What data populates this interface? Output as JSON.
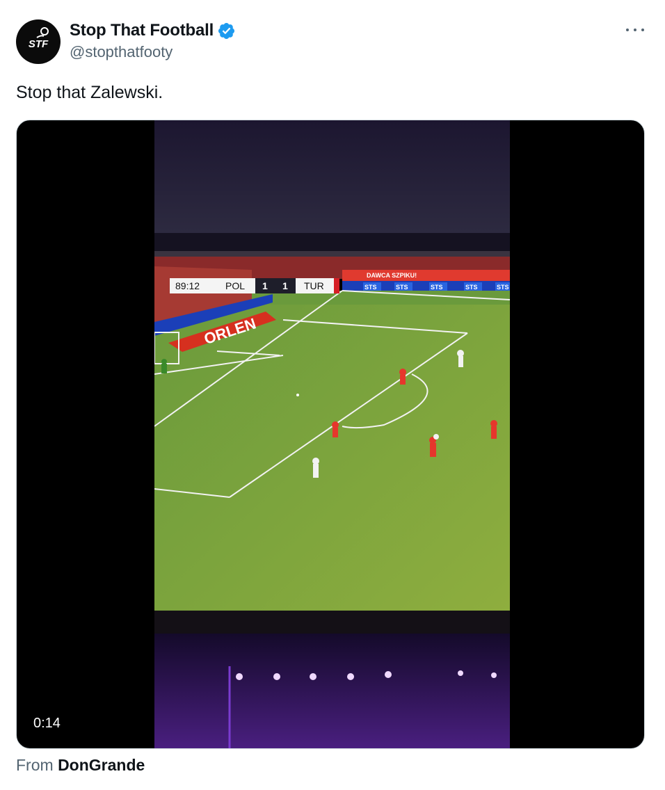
{
  "author": {
    "display_name": "Stop That Football",
    "handle": "@stopthatfooty",
    "avatar_initials": "STF",
    "verified": true
  },
  "tweet": {
    "text": "Stop that Zalewski."
  },
  "video": {
    "duration": "0:14",
    "scoreboard": {
      "clock": "89:12",
      "home_team": "POL",
      "home_score": "1",
      "away_score": "1",
      "away_team": "TUR"
    },
    "ad_board": "ORLEN",
    "ad_sts": "STS",
    "ad_top": "DAWCA SZPIKU!"
  },
  "attribution": {
    "prefix": "From",
    "source_name": "DonGrande"
  },
  "colors": {
    "verified_blue": "#1d9bf0",
    "secondary_text": "#536471",
    "primary_text": "#0f1419"
  },
  "icons": {
    "verified": "verified-badge-icon",
    "more": "more-options-icon"
  }
}
